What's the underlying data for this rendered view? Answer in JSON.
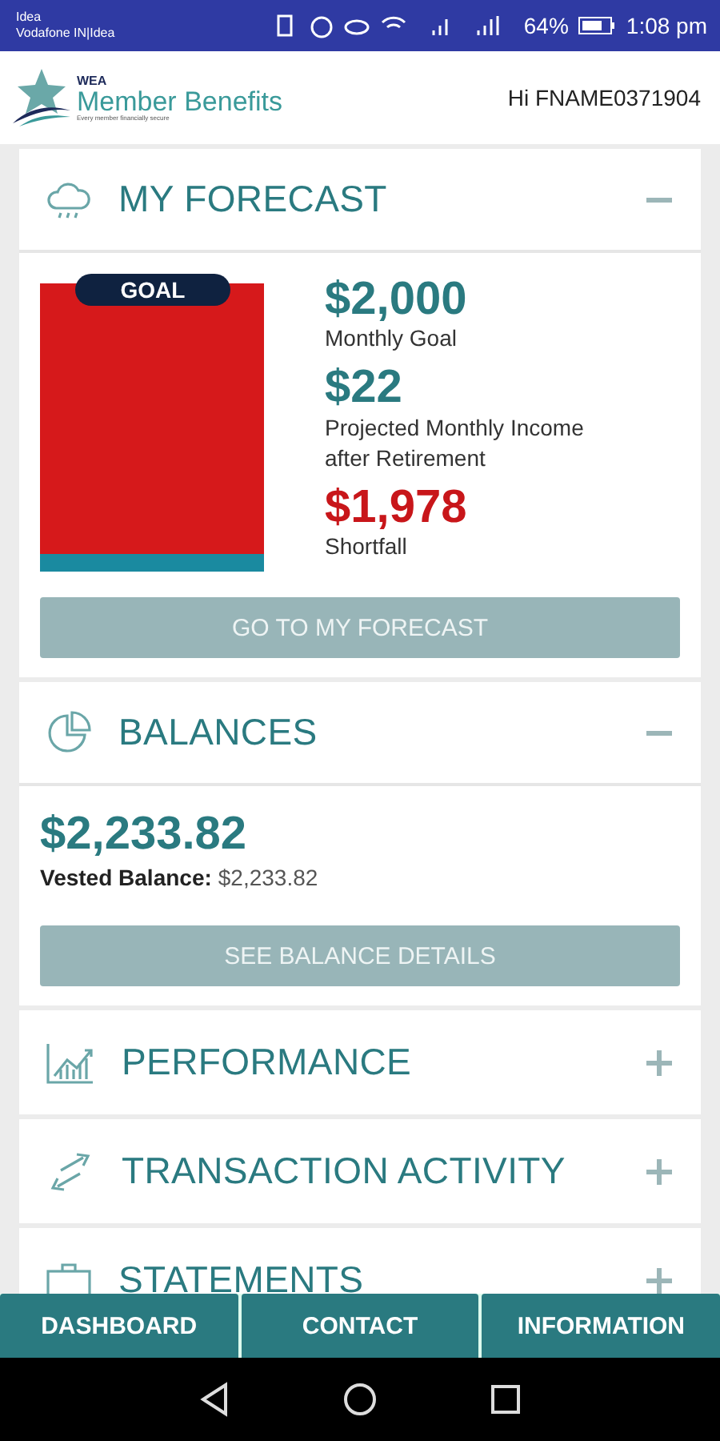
{
  "status_bar": {
    "carrier_1": "Idea",
    "carrier_2": "Vodafone IN|Idea",
    "battery": "64%",
    "time": "1:08 pm"
  },
  "header": {
    "brand_small": "WEA",
    "brand": "Member Benefits",
    "tagline": "Every member financially secure",
    "greeting": "Hi FNAME0371904"
  },
  "forecast": {
    "title": "MY FORECAST",
    "expanded": true,
    "goal_badge": "GOAL",
    "gauge": {
      "level": 0.06
    },
    "figures": [
      {
        "amount": "$2,000",
        "label": "Monthly Goal",
        "kind": "goal"
      },
      {
        "amount": "$22",
        "label": "Projected Monthly Income after Retirement",
        "kind": "goal"
      },
      {
        "amount": "$1,978",
        "label": "Shortfall",
        "kind": "shortfall"
      }
    ],
    "button": "GO TO MY FORECAST"
  },
  "balances": {
    "title": "BALANCES",
    "expanded": true,
    "amount": "$2,233.82",
    "vested_label": "Vested Balance:",
    "vested_value": "$2,233.82",
    "button": "SEE BALANCE DETAILS"
  },
  "sections": [
    {
      "title": "PERFORMANCE",
      "expanded": false
    },
    {
      "title": "TRANSACTION ACTIVITY",
      "expanded": false
    },
    {
      "title": "STATEMENTS",
      "expanded": false
    }
  ],
  "bottom_nav": [
    {
      "label": "DASHBOARD"
    },
    {
      "label": "CONTACT"
    },
    {
      "label": "INFORMATION"
    }
  ]
}
